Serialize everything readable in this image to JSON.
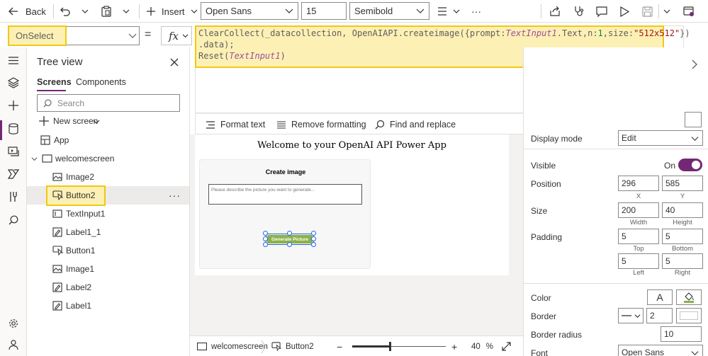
{
  "toolbar": {
    "back_label": "Back",
    "insert_label": "Insert",
    "font_family": "Open Sans",
    "font_size": "15",
    "font_weight": "Semibold",
    "more_label": "···"
  },
  "formula_bar": {
    "property": "OnSelect",
    "equals": "=",
    "fx_label": "fx",
    "code_line1": {
      "a": "ClearCollect(",
      "b": "_datacollection, ",
      "c": "OpenAIAPI.createimage({prompt:",
      "d": "TextInput1",
      "e": ".Text,n:",
      "f": "1",
      "g": ",size:",
      "h": "\"512x512\"",
      "i": "})"
    },
    "code_line2": ".data);",
    "code_line3": {
      "a": "Reset(",
      "b": "TextInput1",
      "c": ")"
    },
    "format_text": "Format text",
    "remove_formatting": "Remove formatting",
    "find_replace": "Find and replace"
  },
  "tree_view": {
    "title": "Tree view",
    "tabs": [
      "Screens",
      "Components"
    ],
    "search_placeholder": "Search",
    "new_screen": "New screen",
    "items": [
      {
        "label": "App",
        "icon": "app-icon"
      },
      {
        "label": "welcomescreen",
        "icon": "screen-icon"
      },
      {
        "label": "Image2",
        "icon": "image-icon"
      },
      {
        "label": "Button2",
        "icon": "button-icon",
        "selected": true
      },
      {
        "label": "TextInput1",
        "icon": "text-input-icon"
      },
      {
        "label": "Label1_1",
        "icon": "label-icon"
      },
      {
        "label": "Button1",
        "icon": "button-icon"
      },
      {
        "label": "Image1",
        "icon": "image-icon"
      },
      {
        "label": "Label2",
        "icon": "label-icon"
      },
      {
        "label": "Label1",
        "icon": "label-icon"
      }
    ]
  },
  "canvas": {
    "welcome_title": "Welcome to your OpenAI API Power App",
    "card_title": "Create image",
    "input_placeholder": "Please describe the picture you want to generate...",
    "button_label": "Generate Picture"
  },
  "status_bar": {
    "screen_crumb": "welcomescreen",
    "control_crumb": "Button2",
    "zoom_value": "40",
    "zoom_unit": "%",
    "zoom_level": 0.4
  },
  "properties": {
    "display_mode_label": "Display mode",
    "display_mode_value": "Edit",
    "visible_label": "Visible",
    "visible_state": "On",
    "position_label": "Position",
    "position_x": "296",
    "position_y": "585",
    "x_label": "X",
    "y_label": "Y",
    "size_label": "Size",
    "width": "200",
    "height": "40",
    "width_label": "Width",
    "height_label": "Height",
    "padding_label": "Padding",
    "padding_top": "5",
    "padding_bottom": "5",
    "padding_left": "5",
    "padding_right": "5",
    "top_label": "Top",
    "bottom_label": "Bottom",
    "left_label": "Left",
    "right_label": "Right",
    "color_label": "Color",
    "color_text_glyph": "A",
    "border_label": "Border",
    "border_width": "2",
    "border_radius_label": "Border radius",
    "border_radius": "10",
    "font_label": "Font",
    "font_value": "Open Sans"
  },
  "colors": {
    "accent": "#742774",
    "highlight_fill": "#fdf0b5",
    "highlight_border": "#f2c811",
    "button_green": "#8cb14a"
  }
}
